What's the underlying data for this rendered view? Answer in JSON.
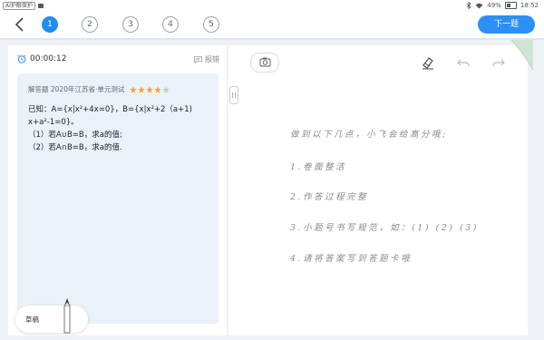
{
  "status_bar": {
    "ai_badge": "AI护眼保护",
    "battery": "49%",
    "time": "18:52"
  },
  "nav": {
    "steps": [
      "1",
      "2",
      "3",
      "4",
      "5"
    ],
    "active_step": "1",
    "next_label": "下一题"
  },
  "question": {
    "timer": "00:00:12",
    "report_label": "报错",
    "meta": "解答题 2020年江苏省·单元测试",
    "difficulty_stars": 4,
    "difficulty_max": 5,
    "lines": [
      "已知：A={x|x²+4x=0}，B={x|x²+2（a+1)",
      "x+a²-1=0}。",
      "（1）若A∪B=B，求a的值;",
      "（2）若A∩B=B，求a的值."
    ]
  },
  "draft": {
    "label": "草稿"
  },
  "answer": {
    "guide_lines": [
      "做到以下几点，小飞会给高分哦;",
      "1.卷面整洁",
      "2.作答过程完整",
      "3.小题号书写规范，如：(1) (2) (3)",
      "4.请将答案写到答题卡哦"
    ]
  },
  "colors": {
    "accent": "#1f8ef1",
    "card_bg": "#eaf1f9",
    "star": "#f5a623"
  }
}
